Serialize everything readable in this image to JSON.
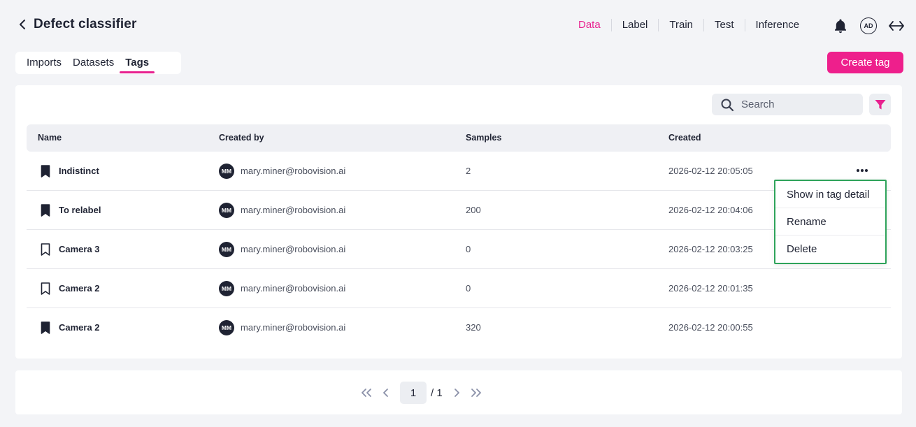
{
  "header": {
    "title": "Defect classifier",
    "nav": [
      "Data",
      "Label",
      "Train",
      "Test",
      "Inference"
    ],
    "active_nav": "Data",
    "avatar_initials": "AD"
  },
  "tabs": [
    "Imports",
    "Datasets",
    "Tags"
  ],
  "active_tab": "Tags",
  "create_button": "Create tag",
  "search": {
    "placeholder": "Search"
  },
  "table": {
    "columns": [
      "Name",
      "Created by",
      "Samples",
      "Created"
    ],
    "rows": [
      {
        "name": "Indistinct",
        "bookmark": "filled",
        "initials": "MM",
        "creator": "mary.miner@robovision.ai",
        "samples": "2",
        "created": "2026-02-12 20:05:05"
      },
      {
        "name": "To relabel",
        "bookmark": "filled",
        "initials": "MM",
        "creator": "mary.miner@robovision.ai",
        "samples": "200",
        "created": "2026-02-12 20:04:06"
      },
      {
        "name": "Camera 3",
        "bookmark": "outline",
        "initials": "MM",
        "creator": "mary.miner@robovision.ai",
        "samples": "0",
        "created": "2026-02-12 20:03:25"
      },
      {
        "name": "Camera 2",
        "bookmark": "outline",
        "initials": "MM",
        "creator": "mary.miner@robovision.ai",
        "samples": "0",
        "created": "2026-02-12 20:01:35"
      },
      {
        "name": "Camera 2",
        "bookmark": "filled",
        "initials": "MM",
        "creator": "mary.miner@robovision.ai",
        "samples": "320",
        "created": "2026-02-12 20:00:55"
      }
    ]
  },
  "context_menu": [
    "Show in tag detail",
    "Rename",
    "Delete"
  ],
  "pagination": {
    "current": "1",
    "total": "/ 1"
  },
  "colors": {
    "accent": "#e8218f",
    "menu_border": "#2ea35a",
    "dark": "#1f2333"
  }
}
